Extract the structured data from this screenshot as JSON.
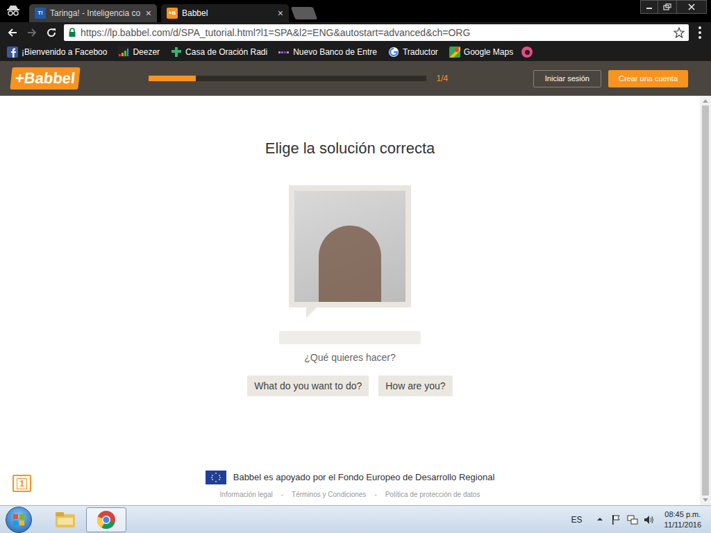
{
  "browser": {
    "tabs": [
      {
        "label": "Taringa! - Inteligencia co",
        "icon": "T!",
        "color": "#1f5aa6",
        "selected": false
      },
      {
        "label": "Babbel",
        "icon": "+B",
        "color": "#f7931e",
        "selected": true
      }
    ],
    "close_glyph": "×",
    "url": "https://lp.babbel.com/d/SPA_tutorial.html?l1=SPA&l2=ENG&autostart=advanced&ch=ORG",
    "bookmarks": [
      {
        "label": "¡Bienvenido a Faceboo",
        "kind": "facebook"
      },
      {
        "label": "Deezer",
        "kind": "deezer"
      },
      {
        "label": "Casa de Oración Radi",
        "kind": "cross"
      },
      {
        "label": "Nuevo Banco de Entre",
        "kind": "dots"
      },
      {
        "label": "Traductor",
        "kind": "google"
      },
      {
        "label": "Google Maps",
        "kind": "maps"
      }
    ]
  },
  "header": {
    "logo": "+Babbel",
    "progress": {
      "level": 0.17,
      "reading": "1/4"
    },
    "login": "Iniciar sesión",
    "signup": "Crear una cuenta"
  },
  "exercise": {
    "title": "Elige la solución correcta",
    "prompt": "¿Qué quieres hacer?",
    "options": [
      {
        "label": "What do you want to do?",
        "selected": false
      },
      {
        "label": "How are you?",
        "selected": false
      }
    ]
  },
  "footer": {
    "badge": "1",
    "eu_text": "Babbel es apoyado por el Fondo Europeo de Desarrollo Regional",
    "links": [
      "Información legal",
      "Términos y Condiciones",
      "Política de protección de datos"
    ],
    "separator": "-"
  },
  "taskbar": {
    "language": "ES",
    "time": "08:45 p.m.",
    "date": "11/11/2016"
  }
}
